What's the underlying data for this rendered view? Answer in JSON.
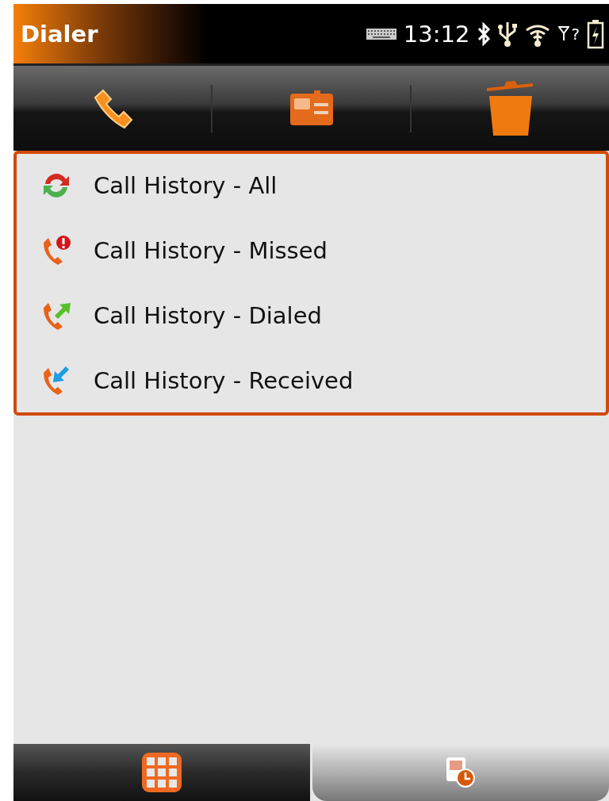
{
  "window": {
    "title": "Dialer"
  },
  "status_bar": {
    "time": "13:12",
    "signal_text": "?"
  },
  "menu": [
    {
      "label": "Call History - All",
      "kind": "all"
    },
    {
      "label": "Call History - Missed",
      "kind": "missed"
    },
    {
      "label": "Call History - Dialed",
      "kind": "dialed"
    },
    {
      "label": "Call History - Received",
      "kind": "received"
    }
  ],
  "tabs": [
    {
      "kind": "keypad",
      "selected": false
    },
    {
      "kind": "history",
      "selected": true
    }
  ]
}
